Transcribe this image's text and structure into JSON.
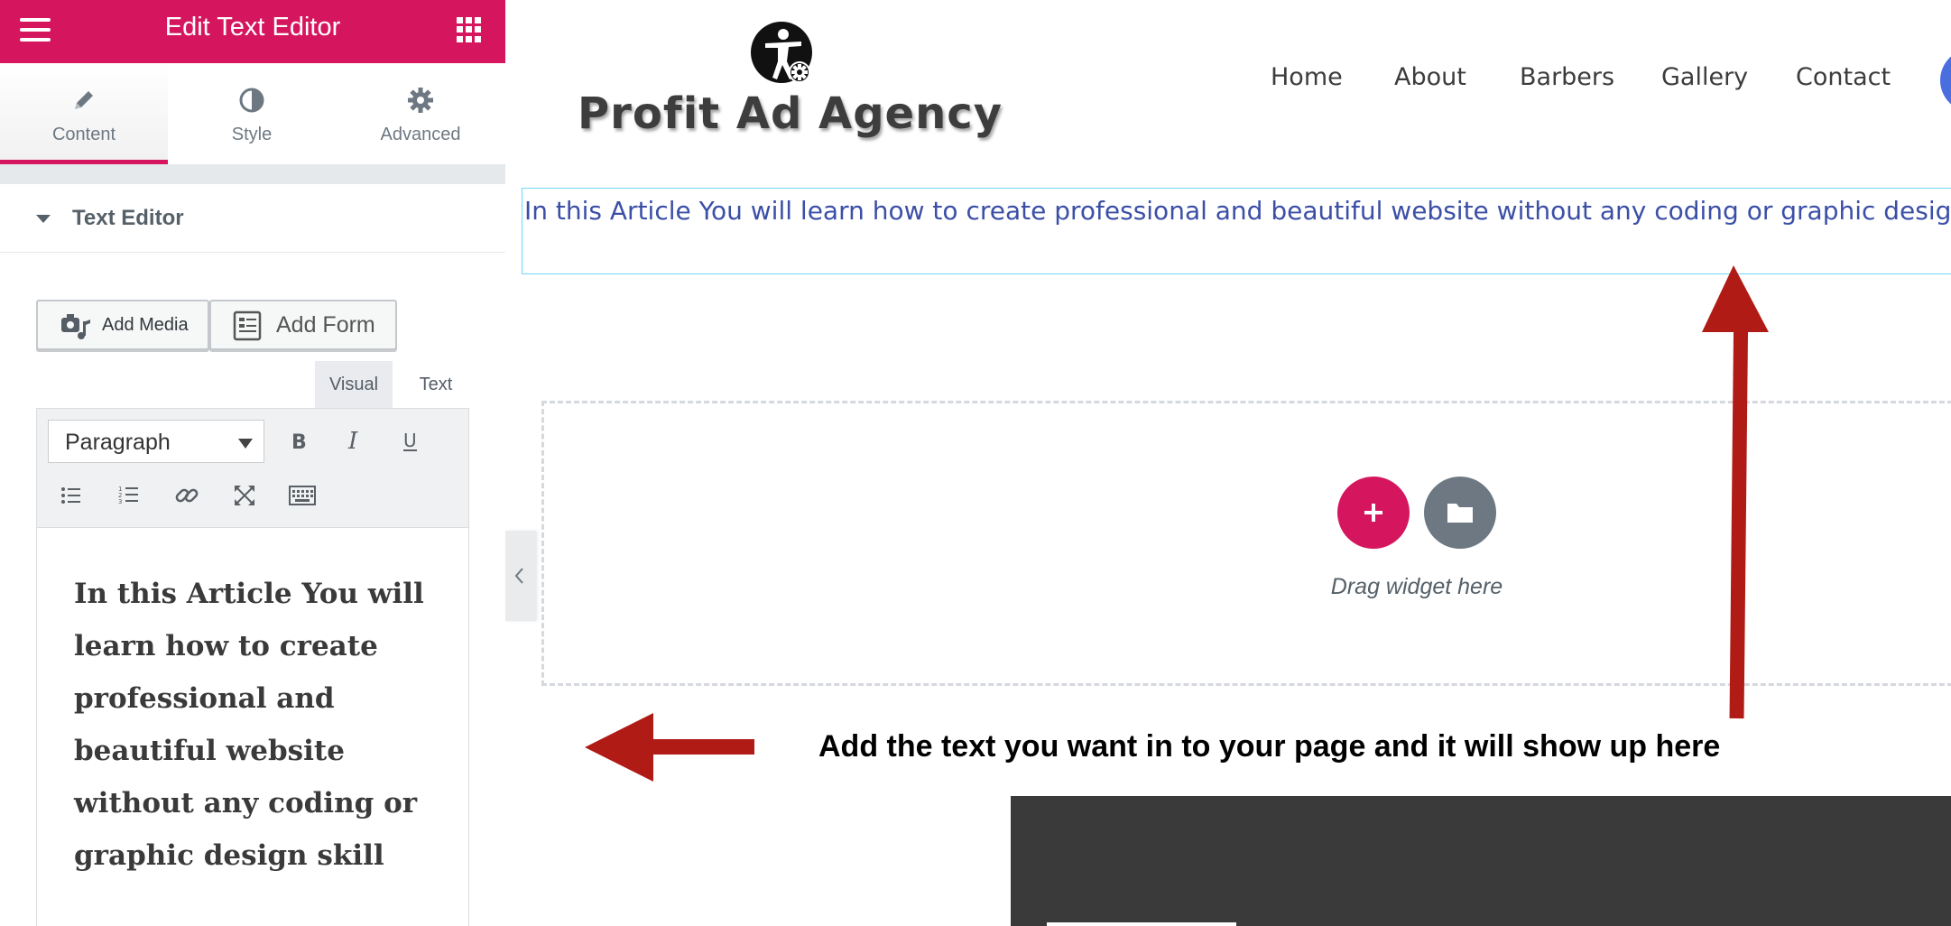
{
  "panel": {
    "title": "Edit Text Editor",
    "tabs": [
      {
        "label": "Content",
        "icon": "pencil-icon",
        "active": true
      },
      {
        "label": "Style",
        "icon": "contrast-icon"
      },
      {
        "label": "Advanced",
        "icon": "gear-icon"
      }
    ],
    "section_title": "Text Editor",
    "add_media_label": "Add Media",
    "add_form_label": "Add Form",
    "view_tabs": {
      "visual": "Visual",
      "text": "Text"
    },
    "format_select": "Paragraph",
    "editor_content": "In this Article You will learn how to create professional and beautiful website without any coding or graphic design skill",
    "accent_color": "#d5165e"
  },
  "site": {
    "logo_text": "Profit Ad Agency",
    "nav": [
      "Home",
      "About",
      "Barbers",
      "Gallery",
      "Contact"
    ],
    "widget_text": "In this Article You will learn how to create professional and beautiful website without any coding or graphic design skill",
    "drag_label": "Drag widget here",
    "text_color": "#3b4fa6"
  },
  "annotation": {
    "text": "Add the text you want in to your page and it will show up here",
    "arrow_color": "#b01c15"
  }
}
